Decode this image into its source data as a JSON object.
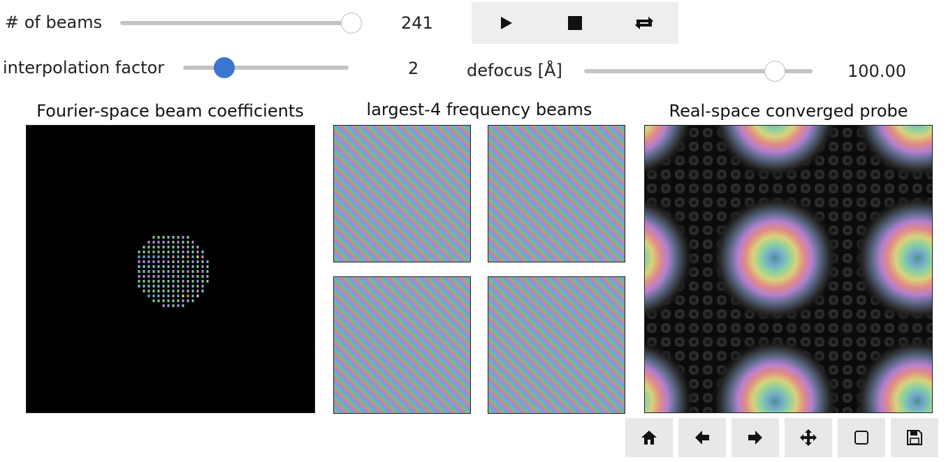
{
  "controls": {
    "beams": {
      "label": "# of beams",
      "value": "241",
      "position": 1.0
    },
    "interpolation": {
      "label": "interpolation factor",
      "value": "2",
      "position": 0.25
    },
    "defocus": {
      "label": "defocus [Å]",
      "value": "100.00",
      "position": 0.84
    }
  },
  "player": {
    "buttons": [
      {
        "name": "play",
        "icon": "play-icon"
      },
      {
        "name": "stop",
        "icon": "stop-icon"
      },
      {
        "name": "loop",
        "icon": "loop-icon"
      }
    ]
  },
  "panels": {
    "fourier": {
      "title": "Fourier-space beam coefficients"
    },
    "beams": {
      "title": "largest-4 frequency beams"
    },
    "probe": {
      "title": "Real-space converged probe"
    }
  },
  "toolbar": {
    "buttons": [
      {
        "name": "home",
        "icon": "home-icon"
      },
      {
        "name": "back",
        "icon": "arrow-left-icon"
      },
      {
        "name": "forward",
        "icon": "arrow-right-icon"
      },
      {
        "name": "pan",
        "icon": "move-icon"
      },
      {
        "name": "zoom",
        "icon": "square-icon"
      },
      {
        "name": "save",
        "icon": "save-icon"
      }
    ]
  },
  "colors": {
    "slider_track": "#c4c4c4",
    "slider_active": "#3a75d0",
    "button_bg": "#eeeeee",
    "toolbar_bg": "#e8e8e8",
    "plot_bg": "#000000"
  }
}
